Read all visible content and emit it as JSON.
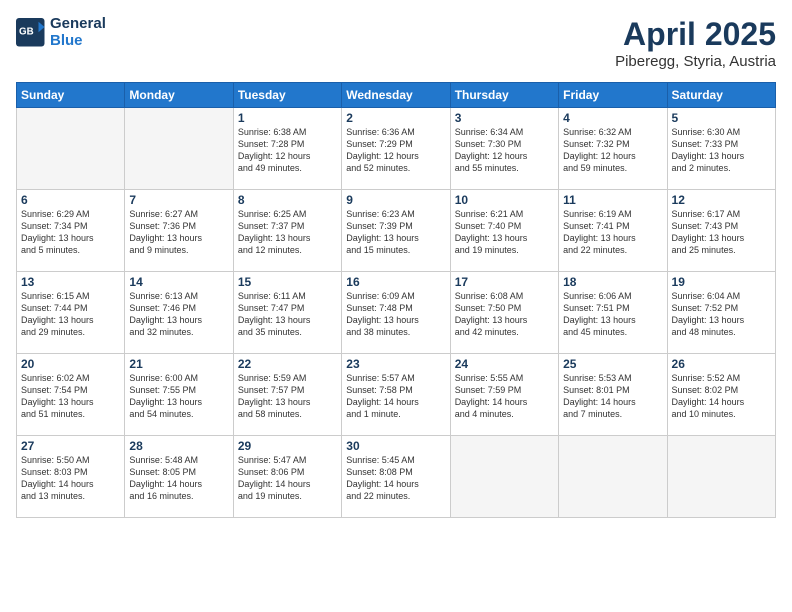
{
  "header": {
    "logo_general": "General",
    "logo_blue": "Blue",
    "month_title": "April 2025",
    "location": "Piberegg, Styria, Austria"
  },
  "weekdays": [
    "Sunday",
    "Monday",
    "Tuesday",
    "Wednesday",
    "Thursday",
    "Friday",
    "Saturday"
  ],
  "weeks": [
    [
      {
        "day": "",
        "detail": ""
      },
      {
        "day": "",
        "detail": ""
      },
      {
        "day": "1",
        "detail": "Sunrise: 6:38 AM\nSunset: 7:28 PM\nDaylight: 12 hours\nand 49 minutes."
      },
      {
        "day": "2",
        "detail": "Sunrise: 6:36 AM\nSunset: 7:29 PM\nDaylight: 12 hours\nand 52 minutes."
      },
      {
        "day": "3",
        "detail": "Sunrise: 6:34 AM\nSunset: 7:30 PM\nDaylight: 12 hours\nand 55 minutes."
      },
      {
        "day": "4",
        "detail": "Sunrise: 6:32 AM\nSunset: 7:32 PM\nDaylight: 12 hours\nand 59 minutes."
      },
      {
        "day": "5",
        "detail": "Sunrise: 6:30 AM\nSunset: 7:33 PM\nDaylight: 13 hours\nand 2 minutes."
      }
    ],
    [
      {
        "day": "6",
        "detail": "Sunrise: 6:29 AM\nSunset: 7:34 PM\nDaylight: 13 hours\nand 5 minutes."
      },
      {
        "day": "7",
        "detail": "Sunrise: 6:27 AM\nSunset: 7:36 PM\nDaylight: 13 hours\nand 9 minutes."
      },
      {
        "day": "8",
        "detail": "Sunrise: 6:25 AM\nSunset: 7:37 PM\nDaylight: 13 hours\nand 12 minutes."
      },
      {
        "day": "9",
        "detail": "Sunrise: 6:23 AM\nSunset: 7:39 PM\nDaylight: 13 hours\nand 15 minutes."
      },
      {
        "day": "10",
        "detail": "Sunrise: 6:21 AM\nSunset: 7:40 PM\nDaylight: 13 hours\nand 19 minutes."
      },
      {
        "day": "11",
        "detail": "Sunrise: 6:19 AM\nSunset: 7:41 PM\nDaylight: 13 hours\nand 22 minutes."
      },
      {
        "day": "12",
        "detail": "Sunrise: 6:17 AM\nSunset: 7:43 PM\nDaylight: 13 hours\nand 25 minutes."
      }
    ],
    [
      {
        "day": "13",
        "detail": "Sunrise: 6:15 AM\nSunset: 7:44 PM\nDaylight: 13 hours\nand 29 minutes."
      },
      {
        "day": "14",
        "detail": "Sunrise: 6:13 AM\nSunset: 7:46 PM\nDaylight: 13 hours\nand 32 minutes."
      },
      {
        "day": "15",
        "detail": "Sunrise: 6:11 AM\nSunset: 7:47 PM\nDaylight: 13 hours\nand 35 minutes."
      },
      {
        "day": "16",
        "detail": "Sunrise: 6:09 AM\nSunset: 7:48 PM\nDaylight: 13 hours\nand 38 minutes."
      },
      {
        "day": "17",
        "detail": "Sunrise: 6:08 AM\nSunset: 7:50 PM\nDaylight: 13 hours\nand 42 minutes."
      },
      {
        "day": "18",
        "detail": "Sunrise: 6:06 AM\nSunset: 7:51 PM\nDaylight: 13 hours\nand 45 minutes."
      },
      {
        "day": "19",
        "detail": "Sunrise: 6:04 AM\nSunset: 7:52 PM\nDaylight: 13 hours\nand 48 minutes."
      }
    ],
    [
      {
        "day": "20",
        "detail": "Sunrise: 6:02 AM\nSunset: 7:54 PM\nDaylight: 13 hours\nand 51 minutes."
      },
      {
        "day": "21",
        "detail": "Sunrise: 6:00 AM\nSunset: 7:55 PM\nDaylight: 13 hours\nand 54 minutes."
      },
      {
        "day": "22",
        "detail": "Sunrise: 5:59 AM\nSunset: 7:57 PM\nDaylight: 13 hours\nand 58 minutes."
      },
      {
        "day": "23",
        "detail": "Sunrise: 5:57 AM\nSunset: 7:58 PM\nDaylight: 14 hours\nand 1 minute."
      },
      {
        "day": "24",
        "detail": "Sunrise: 5:55 AM\nSunset: 7:59 PM\nDaylight: 14 hours\nand 4 minutes."
      },
      {
        "day": "25",
        "detail": "Sunrise: 5:53 AM\nSunset: 8:01 PM\nDaylight: 14 hours\nand 7 minutes."
      },
      {
        "day": "26",
        "detail": "Sunrise: 5:52 AM\nSunset: 8:02 PM\nDaylight: 14 hours\nand 10 minutes."
      }
    ],
    [
      {
        "day": "27",
        "detail": "Sunrise: 5:50 AM\nSunset: 8:03 PM\nDaylight: 14 hours\nand 13 minutes."
      },
      {
        "day": "28",
        "detail": "Sunrise: 5:48 AM\nSunset: 8:05 PM\nDaylight: 14 hours\nand 16 minutes."
      },
      {
        "day": "29",
        "detail": "Sunrise: 5:47 AM\nSunset: 8:06 PM\nDaylight: 14 hours\nand 19 minutes."
      },
      {
        "day": "30",
        "detail": "Sunrise: 5:45 AM\nSunset: 8:08 PM\nDaylight: 14 hours\nand 22 minutes."
      },
      {
        "day": "",
        "detail": ""
      },
      {
        "day": "",
        "detail": ""
      },
      {
        "day": "",
        "detail": ""
      }
    ]
  ]
}
